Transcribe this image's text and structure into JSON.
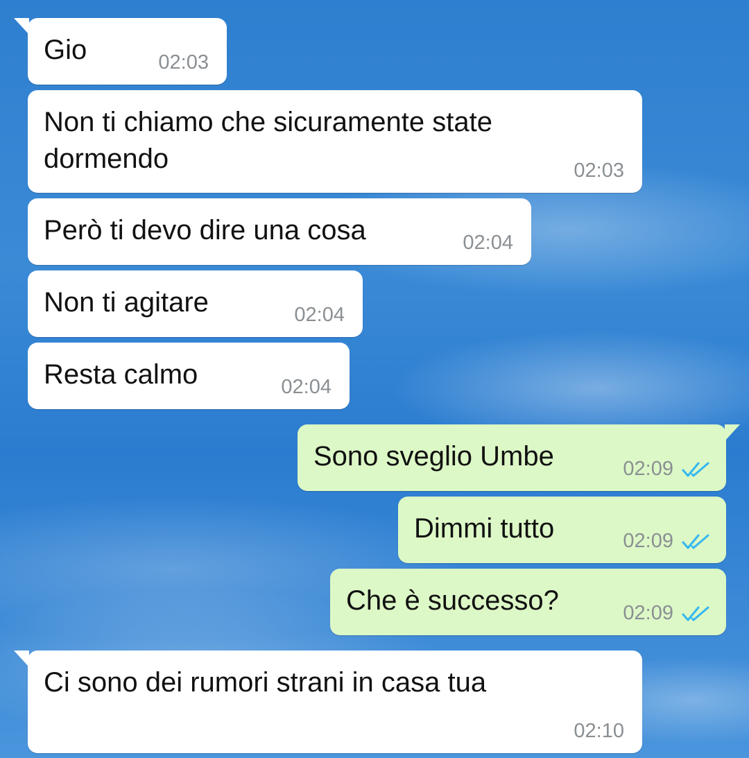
{
  "chat": {
    "messages": [
      {
        "direction": "incoming",
        "text": "Gio",
        "time": "02:03"
      },
      {
        "direction": "incoming",
        "text": "Non ti chiamo che sicuramente state dormendo",
        "time": "02:03"
      },
      {
        "direction": "incoming",
        "text": "Però ti devo dire una cosa",
        "time": "02:04"
      },
      {
        "direction": "incoming",
        "text": "Non ti agitare",
        "time": "02:04"
      },
      {
        "direction": "incoming",
        "text": "Resta calmo",
        "time": "02:04"
      },
      {
        "direction": "outgoing",
        "text": "Sono sveglio Umbe",
        "time": "02:09",
        "status": "read"
      },
      {
        "direction": "outgoing",
        "text": "Dimmi tutto",
        "time": "02:09",
        "status": "read"
      },
      {
        "direction": "outgoing",
        "text": "Che è successo?",
        "time": "02:09",
        "status": "read"
      },
      {
        "direction": "incoming",
        "text": "Ci sono dei rumori strani in casa tua",
        "time": "02:10"
      }
    ]
  },
  "colors": {
    "incoming_bubble": "#ffffff",
    "outgoing_bubble": "#dcf8c6",
    "read_ticks": "#34b7f1",
    "timestamp": "#8a8f93",
    "wallpaper": "#2f7fd0"
  },
  "icons": {
    "read_status": "double-check-icon"
  }
}
